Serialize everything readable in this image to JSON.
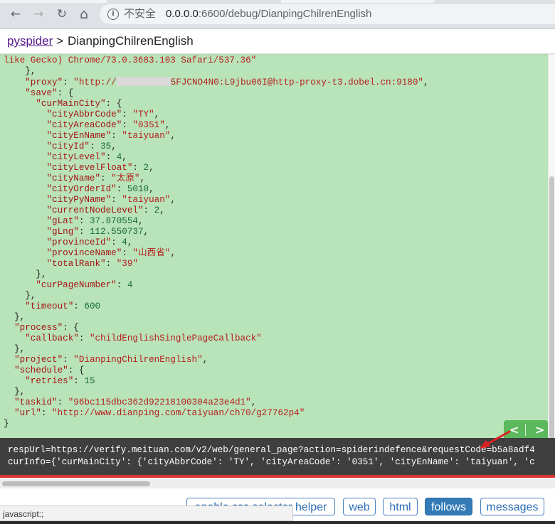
{
  "browser": {
    "back_icon": "←",
    "forward_icon": "→",
    "reload_icon": "↻",
    "home_icon": "⌂",
    "info_icon": "i",
    "insecure_label": "不安全",
    "url_host": "0.0.0.0",
    "url_path": ":6600/debug/DianpingChilrenEnglish"
  },
  "header": {
    "root_link": "pyspider",
    "separator": ">",
    "project": "DianpingChilrenEnglish"
  },
  "json": {
    "ua_tail": "like Gecko) Chrome/73.0.3683.103 Safari/537.36\"",
    "proxy_prefix": "\"http://",
    "proxy_suffix": "5FJCNO4N0:L9jbu06I@http-proxy-t3.dobel.cn:9180\"",
    "cityAbbrCode": "\"TY\"",
    "cityAreaCode": "\"0351\"",
    "cityEnName": "\"taiyuan\"",
    "cityId": "35",
    "cityLevel": "4",
    "cityLevelFloat": "2",
    "cityName": "\"太原\"",
    "cityOrderId": "5010",
    "cityPyName": "\"taiyuan\"",
    "currentNodeLevel": "2",
    "gLat": "37.870554",
    "gLng": "112.550737",
    "provinceId": "4",
    "provinceName": "\"山西省\"",
    "totalRank": "\"39\"",
    "curPageNumber": "4",
    "timeout": "600",
    "callback": "\"childEnglishSinglePageCallback\"",
    "project": "\"DianpingChilrenEnglish\"",
    "retries": "15",
    "taskid": "\"96bc115dbc362d92218100304a23e4d1\"",
    "url": "\"http://www.dianping.com/taiyuan/ch70/g27762p4\""
  },
  "pager": {
    "prev": "<",
    "next": ">"
  },
  "response": {
    "line1": "respUrl=https://verify.meituan.com/v2/web/general_page?action=spiderindefence&requestCode=b5a8adf4",
    "line2": "curInfo={'curMainCity': {'cityAbbrCode': 'TY', 'cityAreaCode': '0351', 'cityEnName': 'taiyuan', 'c"
  },
  "tabs": {
    "css_helper": "enable css selector helper",
    "web": "web",
    "html": "html",
    "follows": "follows",
    "messages": "messages"
  },
  "status_bar": "javascript:;",
  "colors": {
    "json_bg": "#b9e3b9",
    "key": "#a31515",
    "number": "#186a3b",
    "accent": "#337ab7",
    "pager": "#5cb85c",
    "error_line": "#dd3333"
  }
}
